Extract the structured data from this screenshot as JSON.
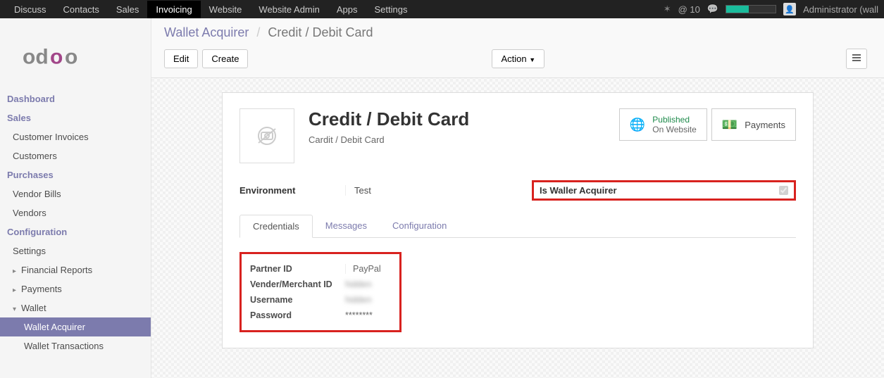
{
  "topnav": {
    "items": [
      "Discuss",
      "Contacts",
      "Sales",
      "Invoicing",
      "Website",
      "Website Admin",
      "Apps",
      "Settings"
    ],
    "active_index": 3,
    "at_count": "@ 10",
    "user": "Administrator (wall"
  },
  "breadcrumb": {
    "parent": "Wallet Acquirer",
    "current": "Credit / Debit Card"
  },
  "toolbar": {
    "edit": "Edit",
    "create": "Create",
    "action": "Action"
  },
  "statbtns": {
    "published_t1": "Published",
    "published_t2": "On Website",
    "payments": "Payments"
  },
  "record": {
    "title": "Credit / Debit Card",
    "subtitle": "Cardit / Debit Card",
    "env_label": "Environment",
    "env_value": "Test",
    "is_wallet_label": "Is Waller Acquirer"
  },
  "tabs": {
    "t1": "Credentials",
    "t2": "Messages",
    "t3": "Configuration"
  },
  "creds": {
    "partner_label": "Partner ID",
    "partner_value": "PayPal",
    "vendor_label": "Vender/Merchant ID",
    "vendor_value": "hidden",
    "user_label": "Username",
    "user_value": "hidden",
    "pass_label": "Password",
    "pass_value": "********"
  },
  "sidebar": {
    "sections": {
      "dashboard": "Dashboard",
      "sales": "Sales",
      "purchases": "Purchases",
      "configuration": "Configuration"
    },
    "items": {
      "cust_inv": "Customer Invoices",
      "customers": "Customers",
      "vendor_bills": "Vendor Bills",
      "vendors": "Vendors",
      "settings": "Settings",
      "fin_reports": "Financial Reports",
      "payments": "Payments",
      "wallet": "Wallet",
      "wallet_acq": "Wallet Acquirer",
      "wallet_tx": "Wallet Transactions"
    }
  }
}
